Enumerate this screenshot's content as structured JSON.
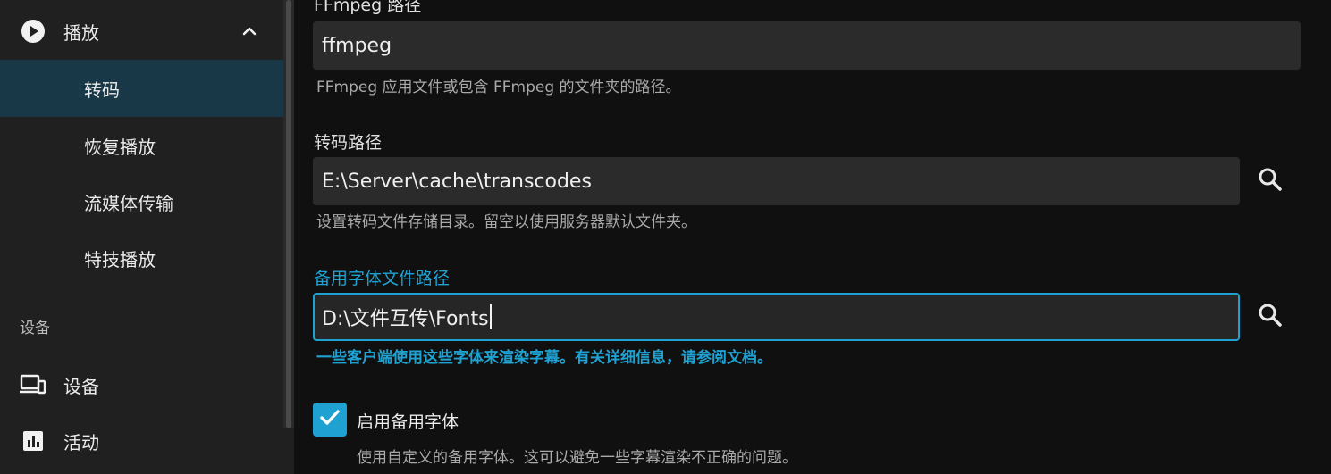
{
  "sidebar": {
    "playback": {
      "label": "播放",
      "icon": "play-circle-icon",
      "expand_icon": "chevron-up-icon"
    },
    "items": [
      {
        "label": "转码",
        "active": true
      },
      {
        "label": "恢复播放",
        "active": false
      },
      {
        "label": "流媒体传输",
        "active": false
      },
      {
        "label": "特技播放",
        "active": false
      }
    ],
    "devices_header": "设备",
    "devices": {
      "label": "设备",
      "icon": "devices-icon"
    },
    "activity": {
      "label": "活动",
      "icon": "bar-chart-icon"
    }
  },
  "main": {
    "ffmpeg": {
      "label": "FFmpeg 路径",
      "value": "ffmpeg",
      "help": "FFmpeg 应用文件或包含 FFmpeg 的文件夹的路径。"
    },
    "transcode": {
      "label": "转码路径",
      "value": "E:\\Server\\cache\\transcodes",
      "help": "设置转码文件存储目录。留空以使用服务器默认文件夹。",
      "search_icon": "search-icon"
    },
    "fallback_font": {
      "label": "备用字体文件路径",
      "value": "D:\\文件互传\\Fonts",
      "help": "一些客户端使用这些字体来渲染字幕。有关详细信息，请参阅文档。",
      "search_icon": "search-icon"
    },
    "enable_fallback": {
      "label": "启用备用字体",
      "checked": true,
      "help": "使用自定义的备用字体。这可以避免一些字幕渲染不正确的问题。"
    }
  },
  "colors": {
    "accent": "#1fa1d1",
    "active_item_bg": "#193847",
    "sidebar_bg": "#202020",
    "main_bg": "#101010",
    "input_bg": "#2b2b2b"
  }
}
